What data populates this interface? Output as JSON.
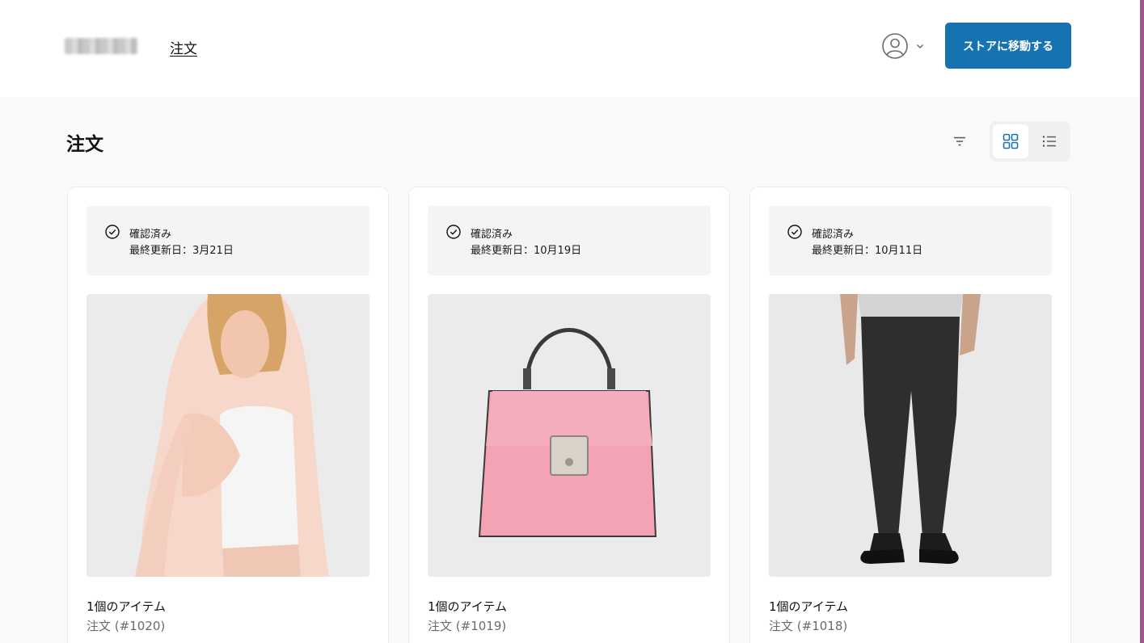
{
  "header": {
    "nav_link": "注文",
    "store_button": "ストアに移動する",
    "icons": {
      "account": "user-circle-icon",
      "dropdown": "chevron-down-icon"
    }
  },
  "main": {
    "title": "注文",
    "icons": {
      "filter": "filter-icon",
      "grid_view": "grid-view-icon",
      "list_view": "list-view-icon"
    },
    "active_view": "grid"
  },
  "orders": [
    {
      "status": "確認済み",
      "updated": "最終更新日：3月21日",
      "item_count": "1個のアイテム",
      "order_number": "注文 (#1020)",
      "image": "woman-pink-scarf-photo"
    },
    {
      "status": "確認済み",
      "updated": "最終更新日：10月19日",
      "item_count": "1個のアイテム",
      "order_number": "注文 (#1019)",
      "image": "pink-handbag-photo"
    },
    {
      "status": "確認済み",
      "updated": "最終更新日：10月11日",
      "item_count": "1個のアイテム",
      "order_number": "注文 (#1018)",
      "image": "black-jeans-photo"
    }
  ],
  "colors": {
    "accent": "#1773b0",
    "page_background": "#fafafa",
    "card_background": "#ffffff",
    "status_background": "#f4f4f4"
  }
}
